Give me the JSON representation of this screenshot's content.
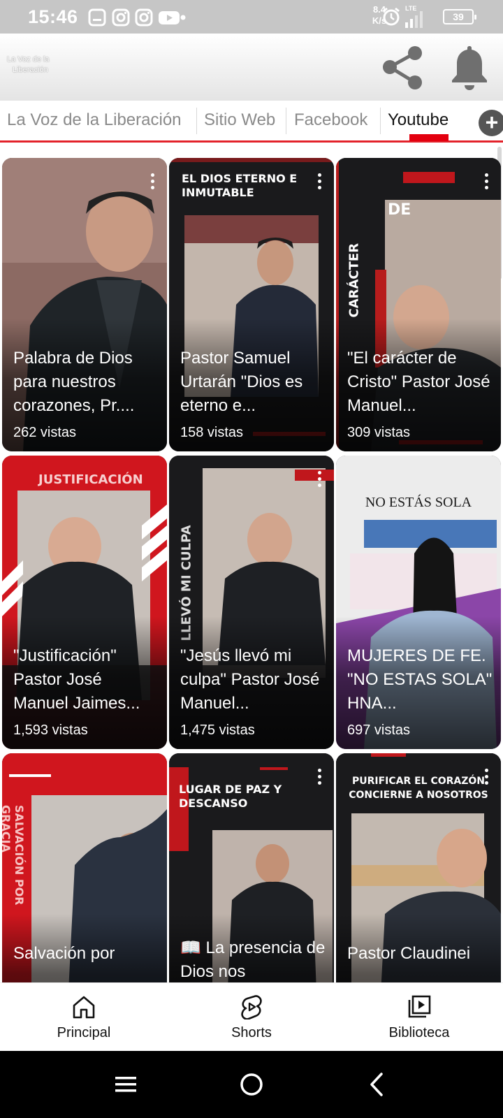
{
  "status_bar": {
    "time": "15:46",
    "net_speed_value": "8.4",
    "net_speed_unit": "K/s",
    "network_type": "LTE",
    "battery": "39",
    "icons": [
      "notification-icon",
      "instagram-icon",
      "instagram-icon",
      "youtube-icon",
      "dot-icon",
      "alarm-icon",
      "signal-icon"
    ]
  },
  "header": {
    "logo_line1": "La Voz de la",
    "logo_line2": "Liberación",
    "actions": [
      "share-icon",
      "bell-icon"
    ]
  },
  "tabs": {
    "items": [
      {
        "label": "La Voz de la Liberación"
      },
      {
        "label": "Sitio Web"
      },
      {
        "label": "Facebook"
      },
      {
        "label": "Youtube"
      }
    ],
    "active": "Youtube",
    "add_label": "+",
    "accent_color": "#e3222b"
  },
  "videos": [
    {
      "title": "Palabra de Dios para nuestros corazones, Pr....",
      "views": "262 vistas",
      "overlay_text": ""
    },
    {
      "title": "Pastor Samuel Urtarán \"Dios es eterno e...",
      "views": "158 vistas",
      "overlay_text": "EL DIOS ETERNO E INMUTABLE"
    },
    {
      "title": "\"El carácter de Cristo\" Pastor José Manuel...",
      "views": "309 vistas",
      "overlay_text": "CARÁCTER"
    },
    {
      "title": "\"Justificación\" Pastor José Manuel Jaimes...",
      "views": "1,593 vistas",
      "overlay_text": "JUSTIFICACIÓN"
    },
    {
      "title": "\"Jesús llevó mi culpa\" Pastor José Manuel...",
      "views": "1,475 vistas",
      "overlay_text": "LLEVÓ MI CULPA"
    },
    {
      "title": "MUJERES DE FE. \"NO ESTAS SOLA\" HNA...",
      "views": "697 vistas",
      "overlay_text": "NO ESTÁS SOLA"
    },
    {
      "title": "Salvación por",
      "views": "",
      "overlay_text": "SALVACIÓN POR GRACIA"
    },
    {
      "title": "📖 La presencia de Dios nos",
      "views": "",
      "overlay_text": "LUGAR DE PAZ Y DESCANSO"
    },
    {
      "title": "Pastor Claudinei",
      "views": "",
      "overlay_text": "PURIFICAR EL CORAZÓN CONCIERNE A NOSOTROS"
    }
  ],
  "bottom_nav": [
    {
      "label": "Principal",
      "icon": "home-icon"
    },
    {
      "label": "Shorts",
      "icon": "shorts-icon"
    },
    {
      "label": "Biblioteca",
      "icon": "library-icon"
    }
  ],
  "system_nav": [
    "menu-icon",
    "home-circle-icon",
    "back-icon"
  ]
}
